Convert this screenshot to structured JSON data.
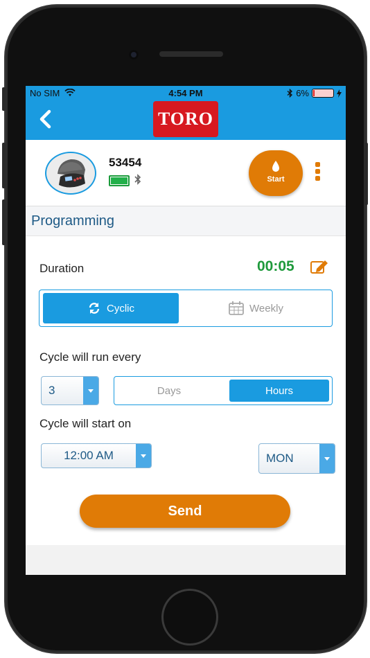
{
  "status_bar": {
    "carrier": "No SIM",
    "time": "4:54 PM",
    "battery_percent": "6%"
  },
  "app_bar": {
    "brand": "TORO"
  },
  "device": {
    "name": "53454",
    "start_label": "Start"
  },
  "section": {
    "title": "Programming"
  },
  "duration": {
    "label": "Duration",
    "value": "00:05"
  },
  "mode": {
    "options": [
      "Cyclic",
      "Weekly"
    ],
    "selected": "Cyclic"
  },
  "cycle_every": {
    "label": "Cycle will run every",
    "value": "3",
    "units": [
      "Days",
      "Hours"
    ],
    "selected_unit": "Hours"
  },
  "cycle_start": {
    "label": "Cycle will start on",
    "time": "12:00 AM",
    "day": "MON"
  },
  "actions": {
    "send_label": "Send"
  },
  "colors": {
    "accent_blue": "#1a9be0",
    "accent_orange": "#e07b06",
    "duration_green": "#1f9a3c",
    "brand_red": "#d71920"
  }
}
